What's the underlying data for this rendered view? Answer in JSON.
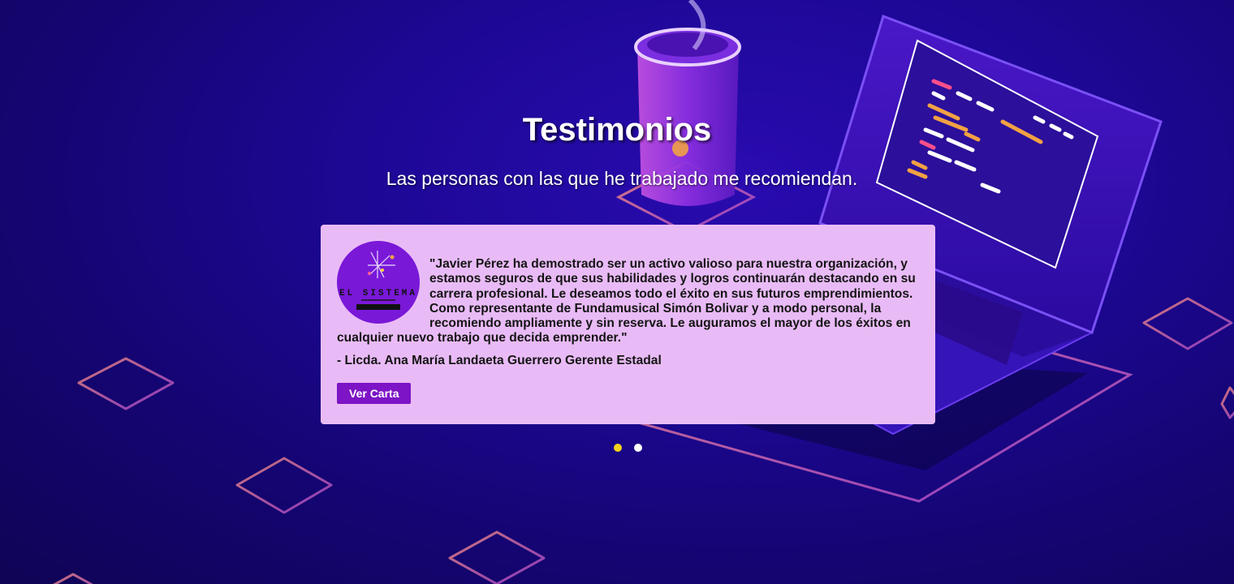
{
  "section": {
    "title": "Testimonios",
    "subtitle": "Las personas con las que he trabajado me recomiendan."
  },
  "testimonial": {
    "quote": "\"Javier Pérez ha demostrado ser un activo valioso para nuestra organización, y estamos seguros de que sus habilidades y logros continuarán destacando en su carrera profesional. Le deseamos todo el éxito en sus futuros emprendimientos. Como representante de Fundamusical Simón Bolivar y a modo personal, la recomiendo ampliamente y sin reserva. Le auguramos el mayor de los éxitos en cualquier nuevo trabajo que decida emprender.\"",
    "author": "- Licda. Ana María Landaeta Guerrero Gerente Estadal",
    "button_label": "Ver Carta",
    "logo_text": "EL SISTEMA"
  },
  "carousel": {
    "slides": 2,
    "active_index": 0,
    "active_color": "#f3d31b",
    "inactive_color": "#ffffff"
  },
  "colors": {
    "background": "#1d0896",
    "card": "#e9bbf6",
    "button": "#7d14c6"
  }
}
